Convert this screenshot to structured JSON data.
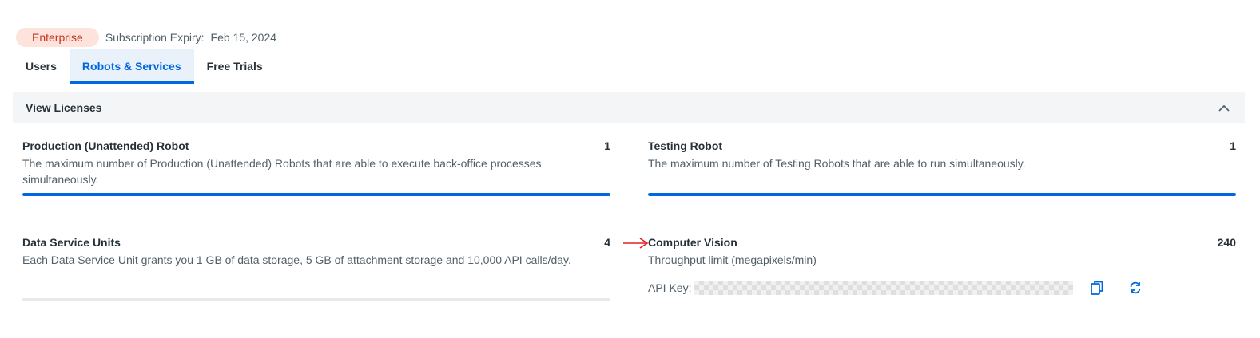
{
  "header": {
    "plan_badge": "Enterprise",
    "expiry_label": "Subscription Expiry:",
    "expiry_value": "Feb 15, 2024"
  },
  "tabs": [
    {
      "label": "Users",
      "active": false
    },
    {
      "label": "Robots & Services",
      "active": true
    },
    {
      "label": "Free Trials",
      "active": false
    }
  ],
  "panel": {
    "title": "View Licenses"
  },
  "licenses": [
    {
      "title": "Production (Unattended) Robot",
      "count": "1",
      "description": "The maximum number of Production (Unattended) Robots that are able to execute back-office processes simultaneously.",
      "usage_fraction": 1.0
    },
    {
      "title": "Testing Robot",
      "count": "1",
      "description": "The maximum number of Testing Robots that are able to run simultaneously.",
      "usage_fraction": 1.0
    },
    {
      "title": "Data Service Units",
      "count": "4",
      "description": "Each Data Service Unit grants you 1 GB of data storage, 5 GB of attachment storage and 10,000 API calls/day.",
      "usage_fraction": 0.0
    },
    {
      "title": "Computer Vision",
      "count": "240",
      "description": "Throughput limit (megapixels/min)"
    }
  ],
  "api_key": {
    "label": "API Key:"
  },
  "icons": {
    "collapse": "chevron-up-icon",
    "copy": "copy-icon",
    "refresh": "refresh-icon",
    "pointer": "arrow-right-icon"
  },
  "colors": {
    "accent": "#0067df",
    "badge_bg": "#fde3dc",
    "badge_text": "#c4351c",
    "pointer": "#e02020"
  }
}
